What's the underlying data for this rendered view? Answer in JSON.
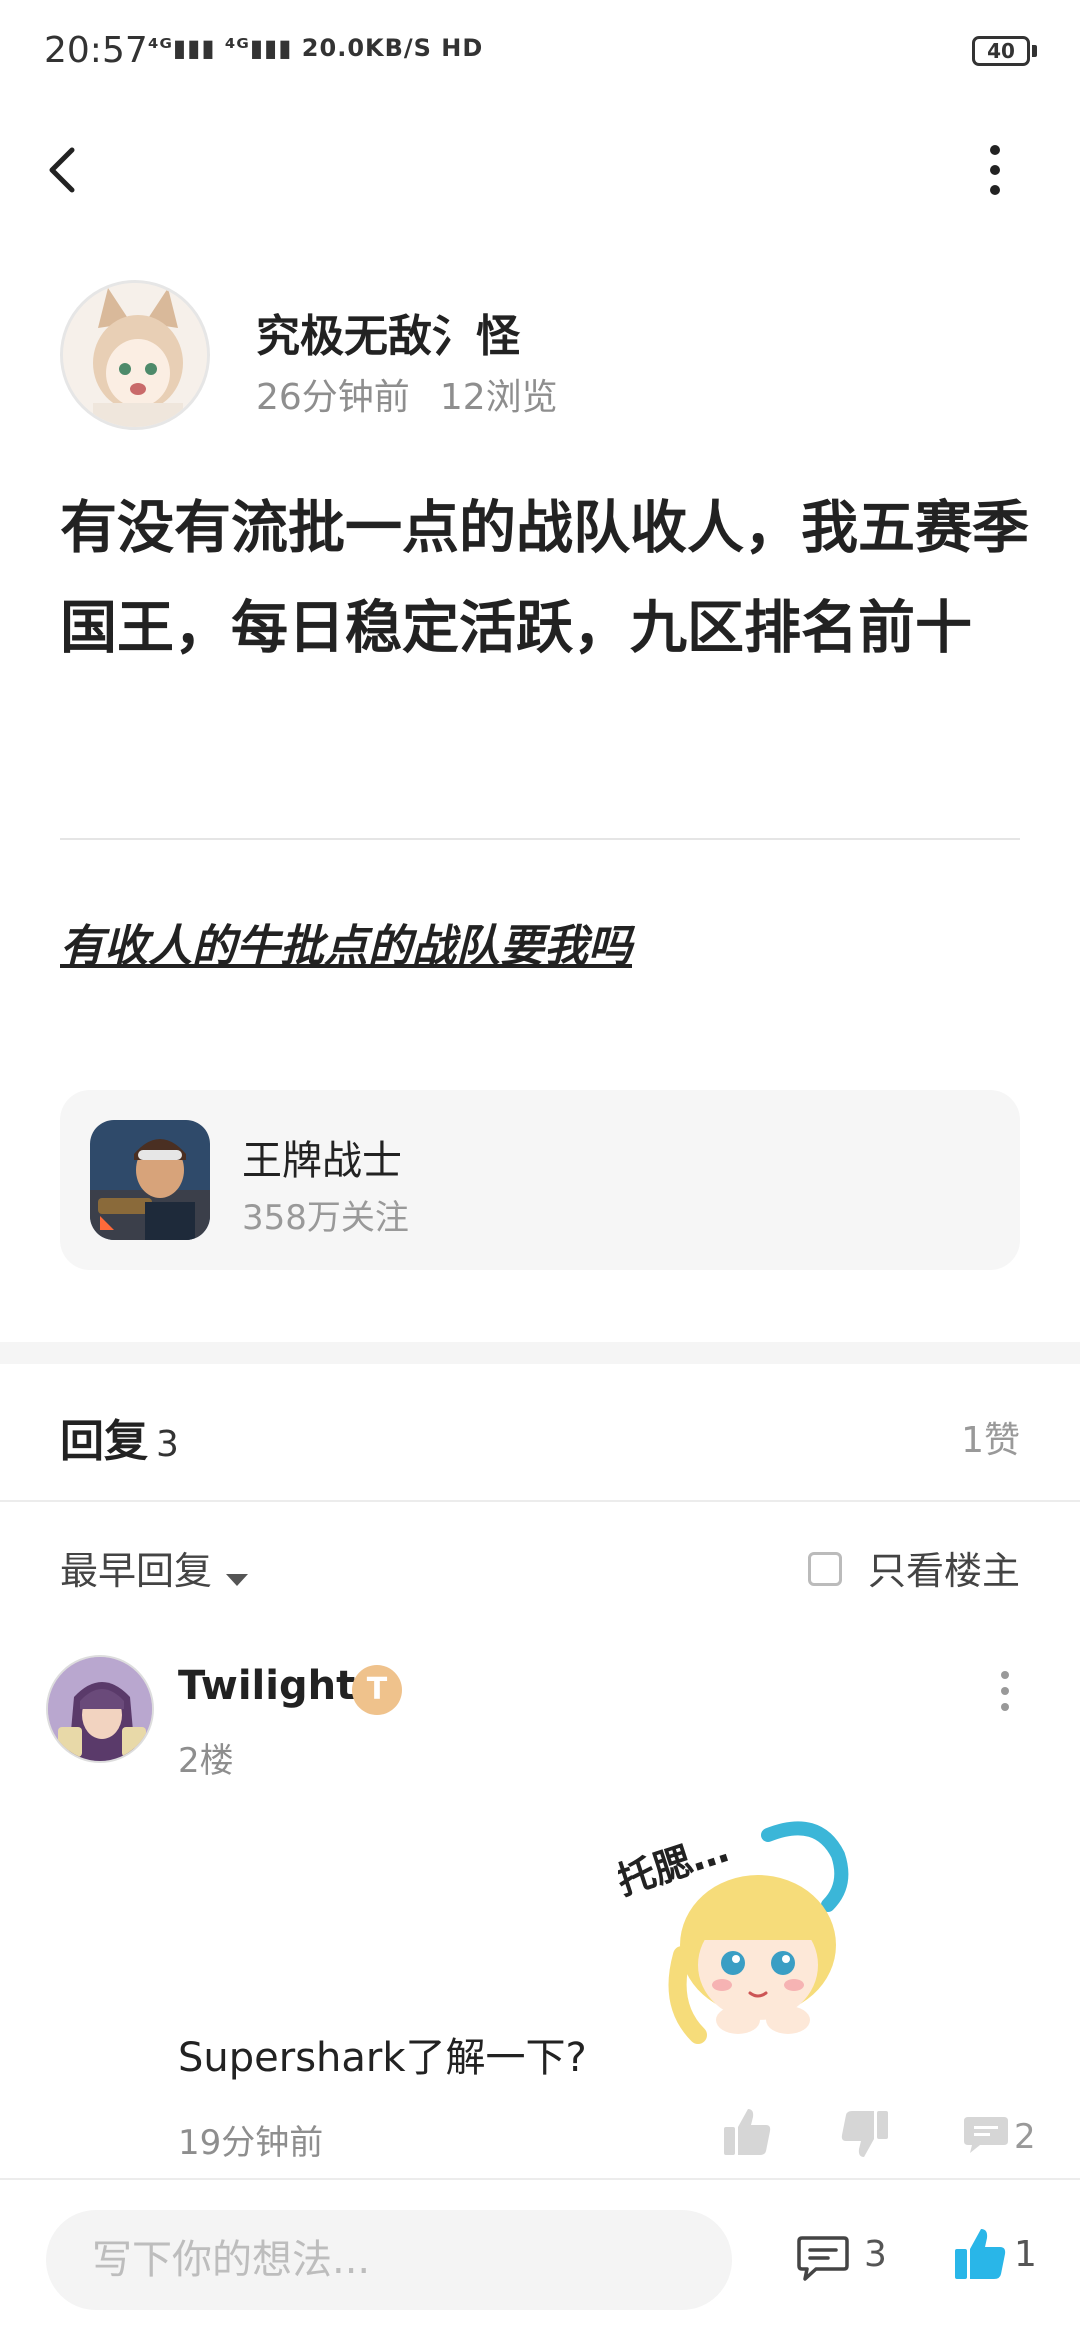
{
  "status_bar": {
    "time": "20:57",
    "network": "⁴ᴳ▮▮▮ ⁴ᴳ▮▮▮ 20.0KB/S HD",
    "battery": "40"
  },
  "author": {
    "name": "究极无敌氵怪",
    "time_ago": "26分钟前",
    "views": "12浏览"
  },
  "post": {
    "title": "有没有流批一点的战队收人，我五赛季国王，每日稳定活跃，九区排名前十",
    "body": "有收人的牛批点的战队要我吗"
  },
  "game_card": {
    "name": "王牌战士",
    "followers": "358万关注"
  },
  "replies": {
    "title": "回复",
    "count": "3",
    "likes": "1赞",
    "sort_label": "最早回复",
    "op_only_label": "只看楼主"
  },
  "comment": {
    "author": "Twilight.",
    "badge": "T",
    "floor": "2楼",
    "sticker_text": "托腮…",
    "text": "Supershark了解一下?",
    "time": "19分钟前",
    "reply_count": "2"
  },
  "bottom_bar": {
    "input_placeholder": "写下你的想法...",
    "comment_count": "3",
    "like_count": "1"
  },
  "colors": {
    "like_blue": "#29b6e8",
    "badge_gold": "#efc28c"
  }
}
